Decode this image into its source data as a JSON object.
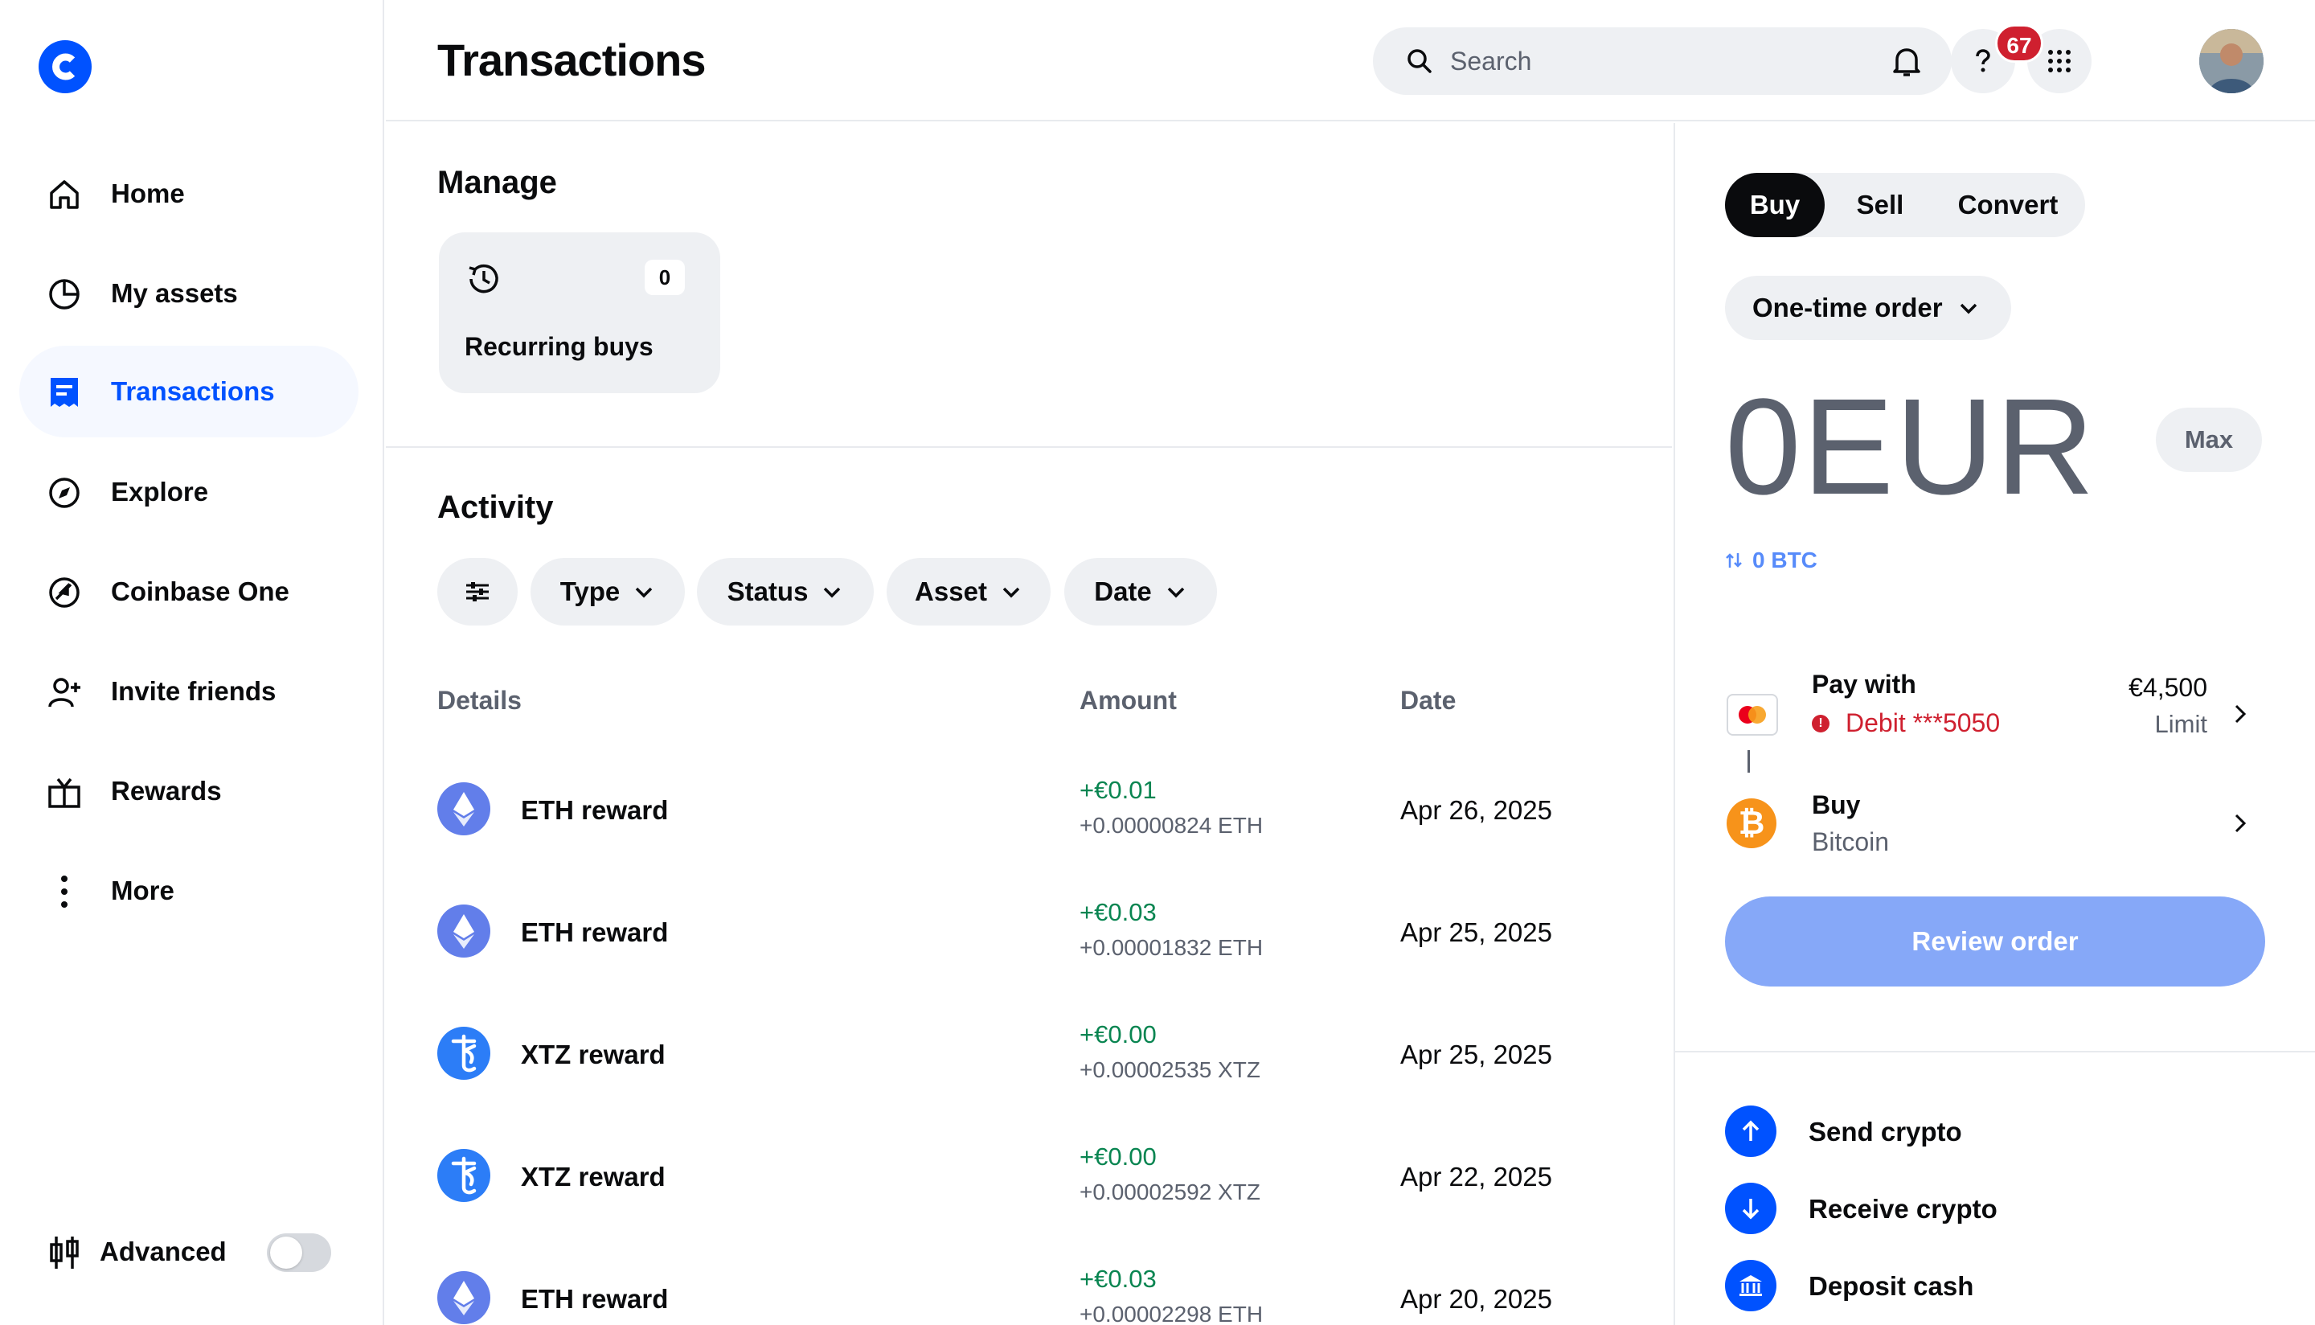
{
  "app": {
    "brand_color": "#0052ff"
  },
  "sidebar": {
    "items": [
      {
        "label": "Home",
        "icon": "home-icon"
      },
      {
        "label": "My assets",
        "icon": "pie-chart-icon"
      },
      {
        "label": "Transactions",
        "icon": "receipt-icon",
        "active": true
      },
      {
        "label": "Explore",
        "icon": "compass-icon"
      },
      {
        "label": "Coinbase One",
        "icon": "coinbase-one-icon"
      },
      {
        "label": "Invite friends",
        "icon": "add-user-icon"
      },
      {
        "label": "Rewards",
        "icon": "gift-icon"
      },
      {
        "label": "More",
        "icon": "more-vertical-icon"
      }
    ],
    "advanced_label": "Advanced",
    "advanced_enabled": false
  },
  "header": {
    "title": "Transactions",
    "search_placeholder": "Search",
    "notification_count": "67"
  },
  "manage": {
    "title": "Manage",
    "recurring_label": "Recurring buys",
    "recurring_count": "0"
  },
  "activity": {
    "title": "Activity",
    "filters": [
      "Type",
      "Status",
      "Asset",
      "Date"
    ],
    "columns": {
      "details": "Details",
      "amount": "Amount",
      "date": "Date"
    },
    "rows": [
      {
        "name": "ETH reward",
        "coin": "eth",
        "fiat": "+€0.01",
        "crypto": "+0.00000824 ETH",
        "date": "Apr 26, 2025"
      },
      {
        "name": "ETH reward",
        "coin": "eth",
        "fiat": "+€0.03",
        "crypto": "+0.00001832 ETH",
        "date": "Apr 25, 2025"
      },
      {
        "name": "XTZ reward",
        "coin": "xtz",
        "fiat": "+€0.00",
        "crypto": "+0.00002535 XTZ",
        "date": "Apr 25, 2025"
      },
      {
        "name": "XTZ reward",
        "coin": "xtz",
        "fiat": "+€0.00",
        "crypto": "+0.00002592 XTZ",
        "date": "Apr 22, 2025"
      },
      {
        "name": "ETH reward",
        "coin": "eth",
        "fiat": "+€0.03",
        "crypto": "+0.00002298 ETH",
        "date": "Apr 20, 2025"
      }
    ]
  },
  "trade": {
    "tabs": [
      "Buy",
      "Sell",
      "Convert"
    ],
    "active_tab": "Buy",
    "order_type": "One-time order",
    "amount": "0EUR",
    "max_label": "Max",
    "conversion": "0 BTC",
    "pay_with_label": "Pay with",
    "payment_method": "Debit ***5050",
    "limit_amount": "€4,500",
    "limit_label": "Limit",
    "buy_label": "Buy",
    "buy_asset": "Bitcoin",
    "review_label": "Review order",
    "actions": [
      "Send crypto",
      "Receive crypto",
      "Deposit cash"
    ]
  }
}
